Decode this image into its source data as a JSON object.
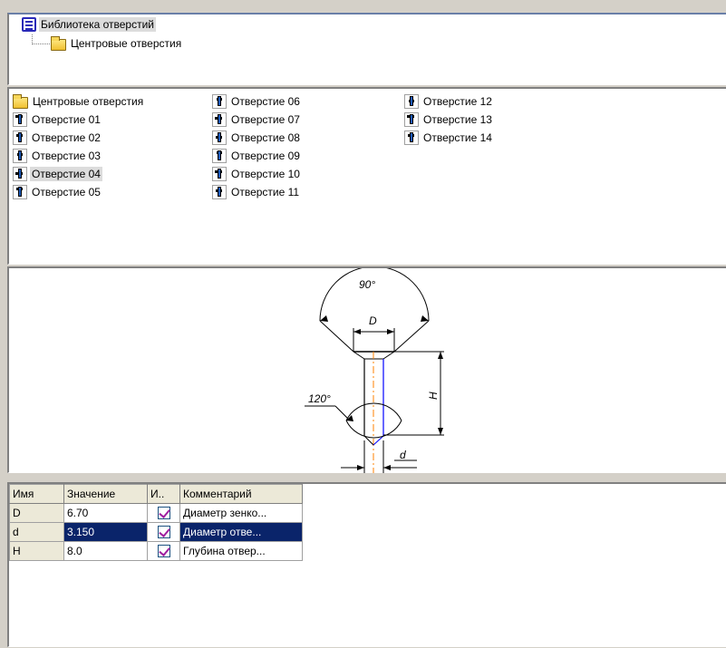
{
  "tree": {
    "root_label": "Библиотека отверстий",
    "child_label": "Центровые отверстия"
  },
  "list": {
    "folder_label": "Центровые отверстия",
    "items": [
      "Отверстие 01",
      "Отверстие 02",
      "Отверстие 03",
      "Отверстие 04",
      "Отверстие 05",
      "Отверстие 06",
      "Отверстие 07",
      "Отверстие 08",
      "Отверстие 09",
      "Отверстие 10",
      "Отверстие 11",
      "Отверстие 12",
      "Отверстие 13",
      "Отверстие 14"
    ],
    "selected_item": "Отверстие 04"
  },
  "drawing": {
    "angle_top": "90°",
    "label_D": "D",
    "label_H": "H",
    "angle_bottom": "120°",
    "label_d": "d"
  },
  "params": {
    "headers": [
      "Имя",
      "Значение",
      "И..",
      "Комментарий"
    ],
    "rows": [
      {
        "name": "D",
        "value": "6.70",
        "checked": true,
        "comment": "Диаметр зенко..."
      },
      {
        "name": "d",
        "value": "3.150",
        "checked": true,
        "comment": "Диаметр отве..."
      },
      {
        "name": "H",
        "value": "8.0",
        "checked": true,
        "comment": "Глубина отвер..."
      }
    ],
    "selected_row": 1
  },
  "colors": {
    "selection": "#0a246a",
    "check_mark": "#a020a0",
    "axis_line": "#ff8000",
    "hidden_line": "#0000ff"
  }
}
